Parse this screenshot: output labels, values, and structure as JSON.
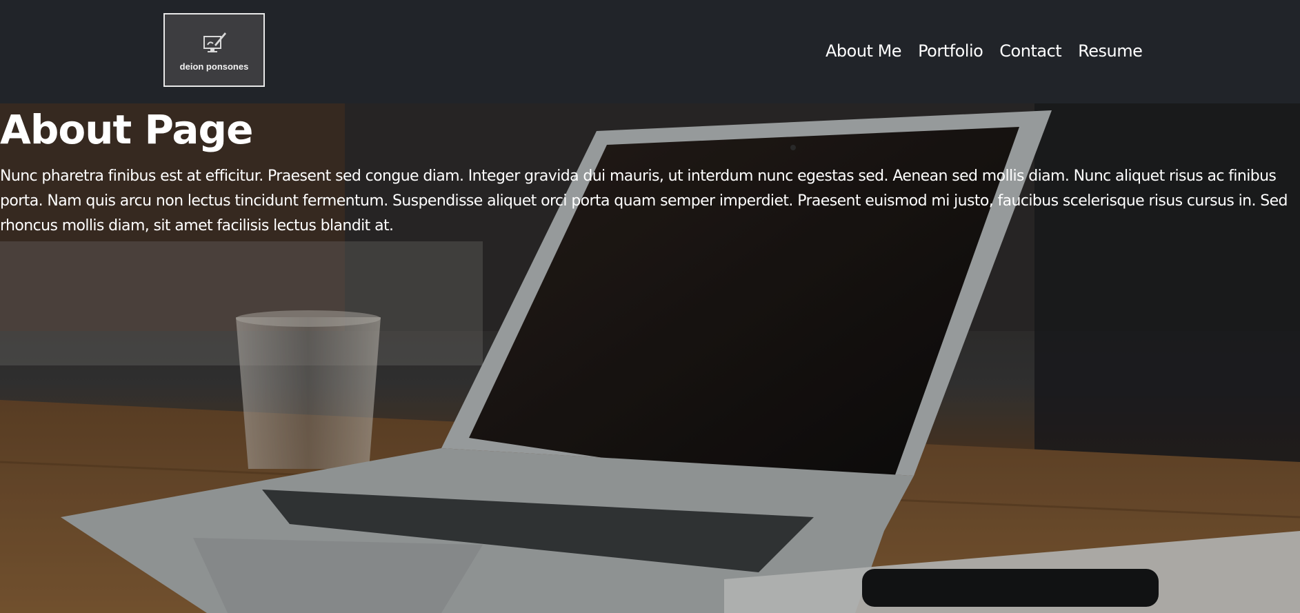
{
  "header": {
    "logo_text": "deion ponsones",
    "nav": [
      {
        "label": "About Me"
      },
      {
        "label": "Portfolio"
      },
      {
        "label": "Contact"
      },
      {
        "label": "Resume"
      }
    ]
  },
  "main": {
    "title": "About Page",
    "body": "Nunc pharetra finibus est at efficitur. Praesent sed congue diam. Integer gravida dui mauris, ut interdum nunc egestas sed. Aenean sed mollis diam. Nunc aliquet risus ac finibus porta. Nam quis arcu non lectus tincidunt fermentum. Suspendisse aliquet orci porta quam semper imperdiet. Praesent euismod mi justo, faucibus scelerisque risus cursus in. Sed rhoncus mollis diam, sit amet facilisis lectus blandit at.",
    "background_image": "laptop-on-desk-photo"
  },
  "colors": {
    "navbar": "#212429",
    "text": "#ffffff"
  }
}
